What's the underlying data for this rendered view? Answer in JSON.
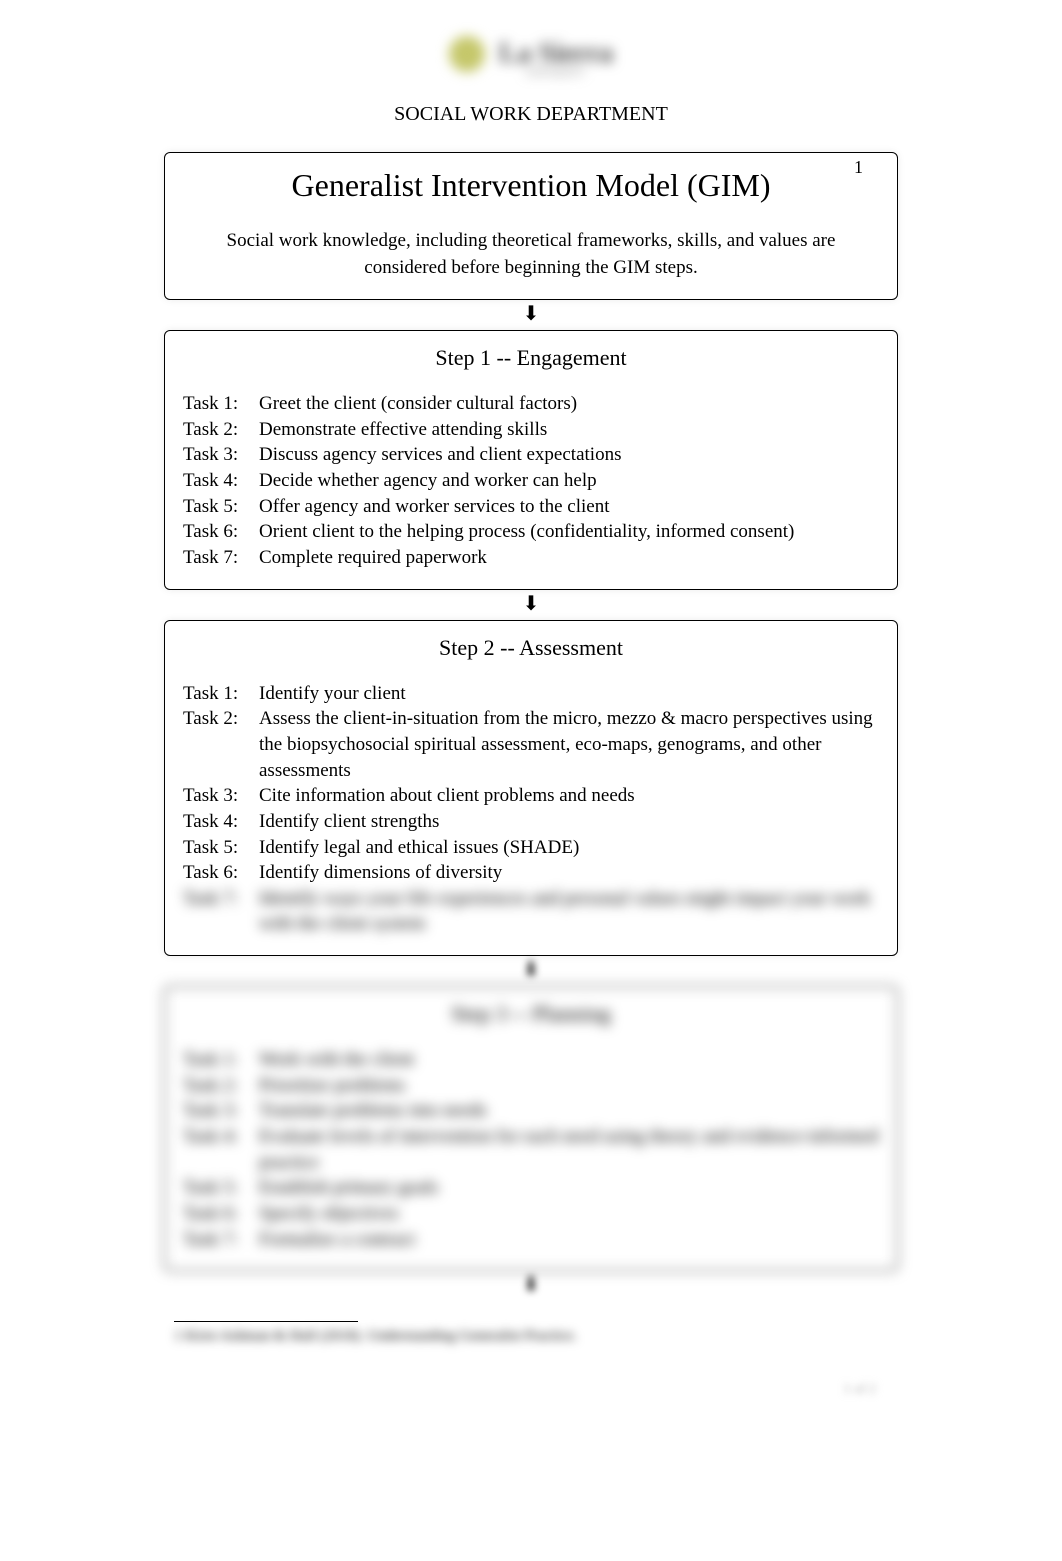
{
  "logo": {
    "name": "La Sierra",
    "subtext": "UNIVERSITY"
  },
  "department": "SOCIAL WORK DEPARTMENT",
  "title": "Generalist Intervention Model (GIM)",
  "footnote_marker": "1",
  "intro": "Social work knowledge, including theoretical frameworks, skills, and values are considered before beginning the GIM steps.",
  "arrow": "⬇",
  "steps": [
    {
      "heading": "Step 1 -- Engagement",
      "tasks": [
        {
          "label": "Task 1:",
          "text": "Greet the client (consider cultural factors)"
        },
        {
          "label": "Task 2:",
          "text": "Demonstrate effective attending skills"
        },
        {
          "label": "Task 3:",
          "text": "Discuss agency services and client expectations"
        },
        {
          "label": "Task 4:",
          "text": "Decide whether agency and worker can help"
        },
        {
          "label": "Task 5:",
          "text": "Offer agency and worker services to the client"
        },
        {
          "label": "Task 6:",
          "text": "Orient client to the helping process (confidentiality, informed consent)"
        },
        {
          "label": "Task 7:",
          "text": "Complete required paperwork"
        }
      ]
    },
    {
      "heading": "Step 2 -- Assessment",
      "tasks": [
        {
          "label": "Task 1:",
          "text": "Identify your client"
        },
        {
          "label": "Task 2:",
          "text": "Assess the client-in-situation from the micro, mezzo & macro perspectives using the biopsychosocial spiritual assessment, eco-maps, genograms, and other assessments"
        },
        {
          "label": "Task 3:",
          "text": "Cite information about client problems and needs"
        },
        {
          "label": "Task 4:",
          "text": "Identify client strengths"
        },
        {
          "label": "Task 5:",
          "text": "Identify legal and ethical issues (SHADE)"
        },
        {
          "label": "Task 6:",
          "text": "Identify dimensions of diversity"
        },
        {
          "label": "Task 7:",
          "text": "Identify ways your life experiences and personal values might impact your work with the client system"
        }
      ]
    },
    {
      "heading": "Step 3 -- Planning",
      "tasks": [
        {
          "label": "Task 1:",
          "text": "Work with the client"
        },
        {
          "label": "Task 2:",
          "text": "Prioritize problems"
        },
        {
          "label": "Task 3:",
          "text": "Translate problems into needs"
        },
        {
          "label": "Task 4:",
          "text": "Evaluate levels of intervention for each need using theory and evidence-informed practice"
        },
        {
          "label": "Task 5:",
          "text": "Establish primary goals"
        },
        {
          "label": "Task 6:",
          "text": "Specify objectives"
        },
        {
          "label": "Task 7:",
          "text": "Formalize a contract"
        }
      ]
    }
  ],
  "footnote": "1 Kirst-Ashman & Hull (2018). Understanding Generalist Practice.",
  "page_number": "1 of 2"
}
